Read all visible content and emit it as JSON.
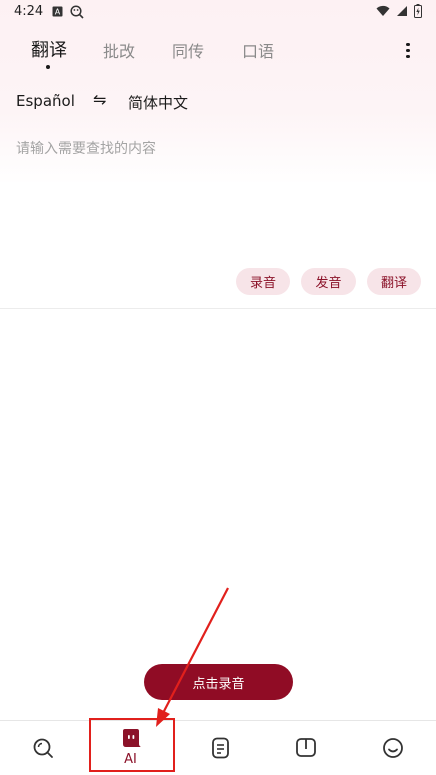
{
  "status_bar": {
    "time": "4:24",
    "icons": [
      "text-a-icon",
      "search-emoji-icon",
      "wifi-icon",
      "signal-icon",
      "battery-charging-icon"
    ]
  },
  "tabs": [
    {
      "label": "翻译",
      "active": true
    },
    {
      "label": "批改",
      "active": false
    },
    {
      "label": "同传",
      "active": false
    },
    {
      "label": "口语",
      "active": false
    }
  ],
  "lang": {
    "source": "Español",
    "swap": "⇋",
    "target": "简体中文"
  },
  "input": {
    "placeholder": "请输入需要查找的内容"
  },
  "actions": {
    "record": "录音",
    "pronounce": "发音",
    "translate": "翻译"
  },
  "record_button": {
    "label": "点击录音"
  },
  "bottom_nav": {
    "items": [
      {
        "icon": "search-icon"
      },
      {
        "icon": "ai-bot-icon",
        "label": "AI",
        "active": true
      },
      {
        "icon": "document-icon"
      },
      {
        "icon": "book-icon"
      },
      {
        "icon": "smiley-icon"
      }
    ]
  },
  "colors": {
    "accent": "#900c25",
    "accent_text": "#8b1229",
    "chip_bg": "#f7e4e8",
    "annotation_red": "#e1201c"
  }
}
